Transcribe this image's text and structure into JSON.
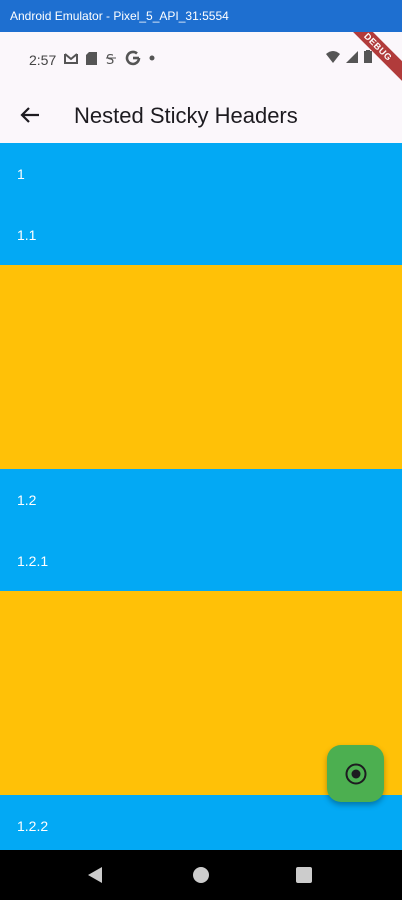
{
  "window": {
    "title": "Android Emulator - Pixel_5_API_31:5554"
  },
  "status_bar": {
    "time": "2:57",
    "debug_label": "DEBUG"
  },
  "app_bar": {
    "title": "Nested Sticky Headers"
  },
  "list": {
    "headers": [
      "1",
      "1.1",
      "1.2",
      "1.2.1",
      "1.2.2"
    ]
  },
  "colors": {
    "header_bg": "#03a9f4",
    "block_bg": "#ffc107",
    "fab_bg": "#4caf50"
  },
  "icons": {
    "back": "arrow-back-icon",
    "fab": "radio-button-checked-icon",
    "nav_back": "triangle-back-icon",
    "nav_home": "circle-home-icon",
    "nav_recents": "square-recents-icon"
  }
}
